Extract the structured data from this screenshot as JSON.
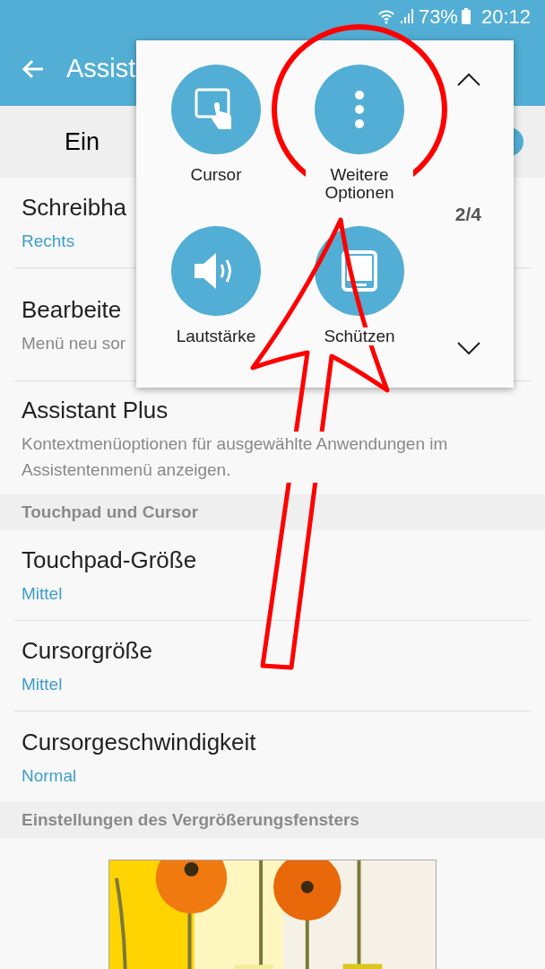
{
  "status_bar": {
    "battery": "73%",
    "time": "20:12"
  },
  "app_bar": {
    "title": "Assist"
  },
  "master_switch": {
    "label": "Ein",
    "on": true
  },
  "sections": [
    {
      "items": [
        {
          "title": "Schreibha",
          "subtitle": "Rechts",
          "kind": "value"
        },
        {
          "title": "Bearbeite",
          "subtitle": "Menü neu sor",
          "kind": "description"
        },
        {
          "title": "Assistant Plus",
          "subtitle": "Kontextmenüoptionen für ausgewählte Anwendungen im Assistentenmenü anzeigen.",
          "kind": "description"
        }
      ]
    },
    {
      "header": "Touchpad und Cursor",
      "items": [
        {
          "title": "Touchpad-Größe",
          "subtitle": "Mittel",
          "kind": "value"
        },
        {
          "title": "Cursorgröße",
          "subtitle": "Mittel",
          "kind": "value"
        },
        {
          "title": "Cursorgeschwindigkeit",
          "subtitle": "Normal",
          "kind": "value"
        }
      ]
    },
    {
      "header": "Einstellungen des Vergrößerungsfensters"
    }
  ],
  "popup": {
    "items": [
      {
        "label": "Cursor"
      },
      {
        "label": "Weitere Optionen"
      },
      {
        "label": "Lautstärke"
      },
      {
        "label": "Schützen"
      }
    ],
    "page": "2/4"
  }
}
